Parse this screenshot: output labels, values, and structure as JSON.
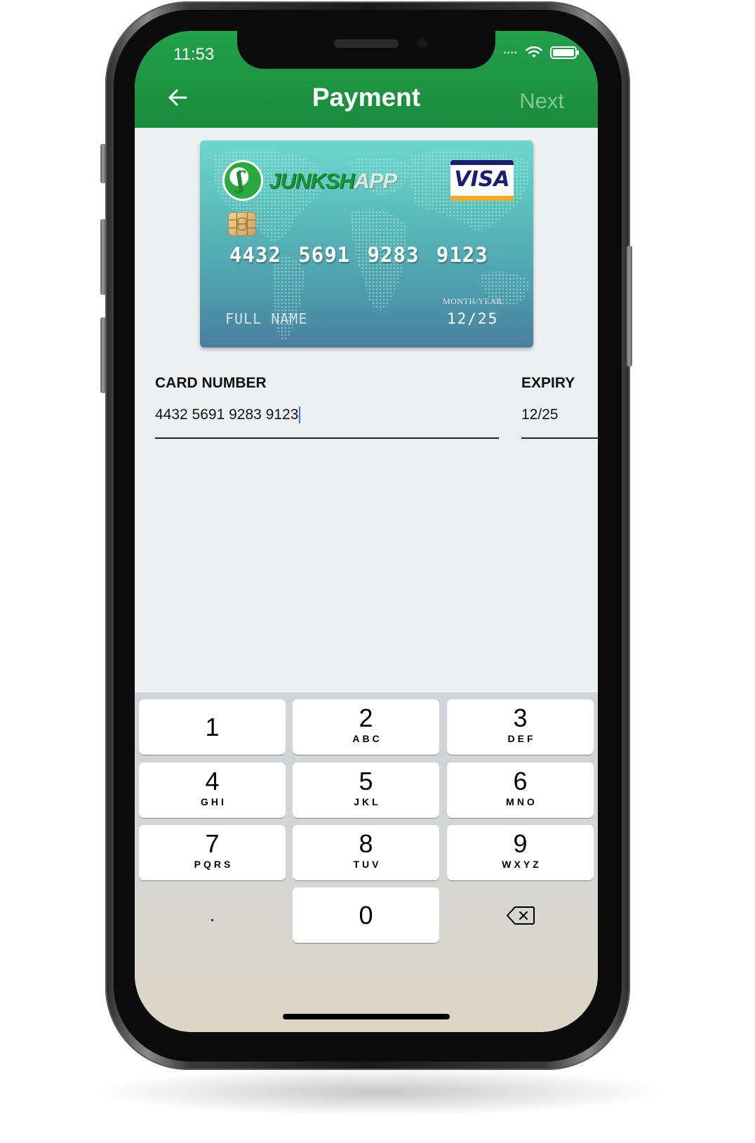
{
  "status_bar": {
    "time": "11:53"
  },
  "header": {
    "title": "Payment",
    "next_label": "Next"
  },
  "card": {
    "brand_name_main": "JUNKSH",
    "brand_name_suffix": "APP",
    "network": "VISA",
    "number": "4432 5691 9283 9123",
    "holder_placeholder": "FULL NAME",
    "month_year_label": "MONTH/YEAR",
    "expiry": "12/25"
  },
  "form": {
    "card_number_label": "CARD NUMBER",
    "card_number_value": "4432 5691 9283 9123",
    "expiry_label": "EXPIRY",
    "expiry_value": "12/25"
  },
  "keyboard": {
    "keys": [
      {
        "num": "1",
        "letters": ""
      },
      {
        "num": "2",
        "letters": "ABC"
      },
      {
        "num": "3",
        "letters": "DEF"
      },
      {
        "num": "4",
        "letters": "GHI"
      },
      {
        "num": "5",
        "letters": "JKL"
      },
      {
        "num": "6",
        "letters": "MNO"
      },
      {
        "num": "7",
        "letters": "PQRS"
      },
      {
        "num": "8",
        "letters": "TUV"
      },
      {
        "num": "9",
        "letters": "WXYZ"
      },
      {
        "num": "0",
        "letters": ""
      }
    ],
    "decimal": "."
  },
  "colors": {
    "header_green": "#1e9443",
    "next_disabled": "#7fc892",
    "visa_blue": "#1a1f71",
    "visa_gold": "#f7a823"
  },
  "icons": {
    "back": "arrow-left-icon",
    "delete": "backspace-icon",
    "wifi": "wifi-icon",
    "battery": "battery-icon"
  }
}
